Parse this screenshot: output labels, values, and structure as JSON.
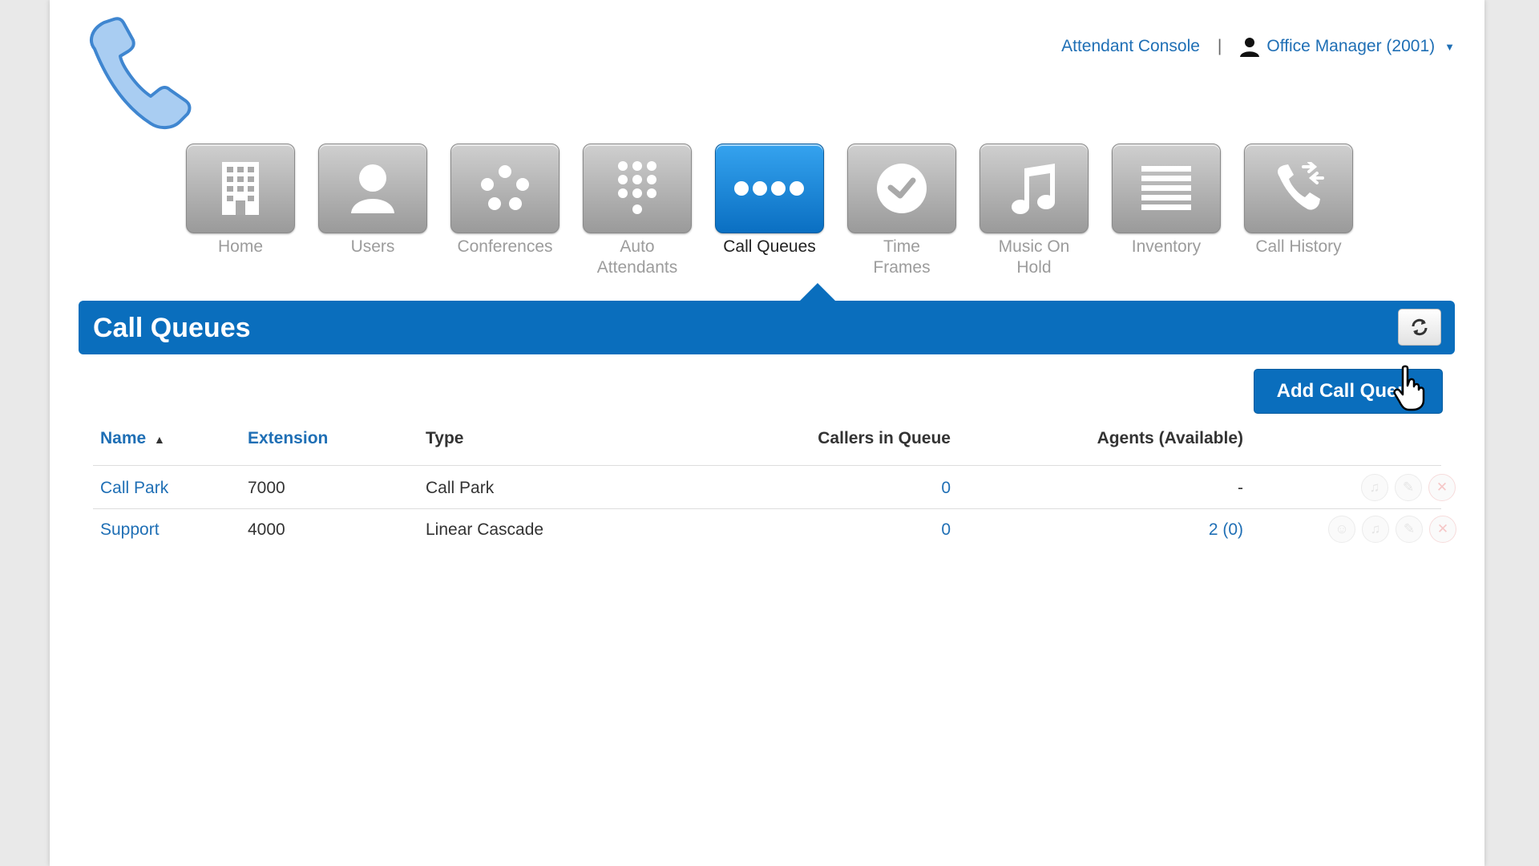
{
  "header": {
    "attendant_console": "Attendant Console",
    "separator": "|",
    "user_label": "Office Manager (2001)"
  },
  "nav": {
    "items": [
      {
        "label_line1": "Home",
        "label_line2": "",
        "icon": "building-icon"
      },
      {
        "label_line1": "Users",
        "label_line2": "",
        "icon": "user-icon"
      },
      {
        "label_line1": "Conferences",
        "label_line2": "",
        "icon": "conference-icon"
      },
      {
        "label_line1": "Auto",
        "label_line2": "Attendants",
        "icon": "keypad-icon"
      },
      {
        "label_line1": "Call Queues",
        "label_line2": "",
        "icon": "queue-dots-icon"
      },
      {
        "label_line1": "Time",
        "label_line2": "Frames",
        "icon": "clock-icon"
      },
      {
        "label_line1": "Music On",
        "label_line2": "Hold",
        "icon": "music-note-icon"
      },
      {
        "label_line1": "Inventory",
        "label_line2": "",
        "icon": "list-icon"
      },
      {
        "label_line1": "Call History",
        "label_line2": "",
        "icon": "call-history-icon"
      }
    ],
    "active": "Call Queues"
  },
  "section": {
    "title": "Call Queues",
    "add_button": "Add Call Queue"
  },
  "table": {
    "headers": {
      "name": "Name",
      "extension": "Extension",
      "type": "Type",
      "callers": "Callers in Queue",
      "agents": "Agents (Available)"
    },
    "sort": "ascending",
    "rows": [
      {
        "name": "Call Park",
        "extension": "7000",
        "type": "Call Park",
        "callers": "0",
        "agents": "-"
      },
      {
        "name": "Support",
        "extension": "4000",
        "type": "Linear Cascade",
        "callers": "0",
        "agents": "2 (0)"
      }
    ]
  },
  "colors": {
    "brand_blue": "#0a6ebd",
    "link_blue": "#1f6fb5"
  }
}
